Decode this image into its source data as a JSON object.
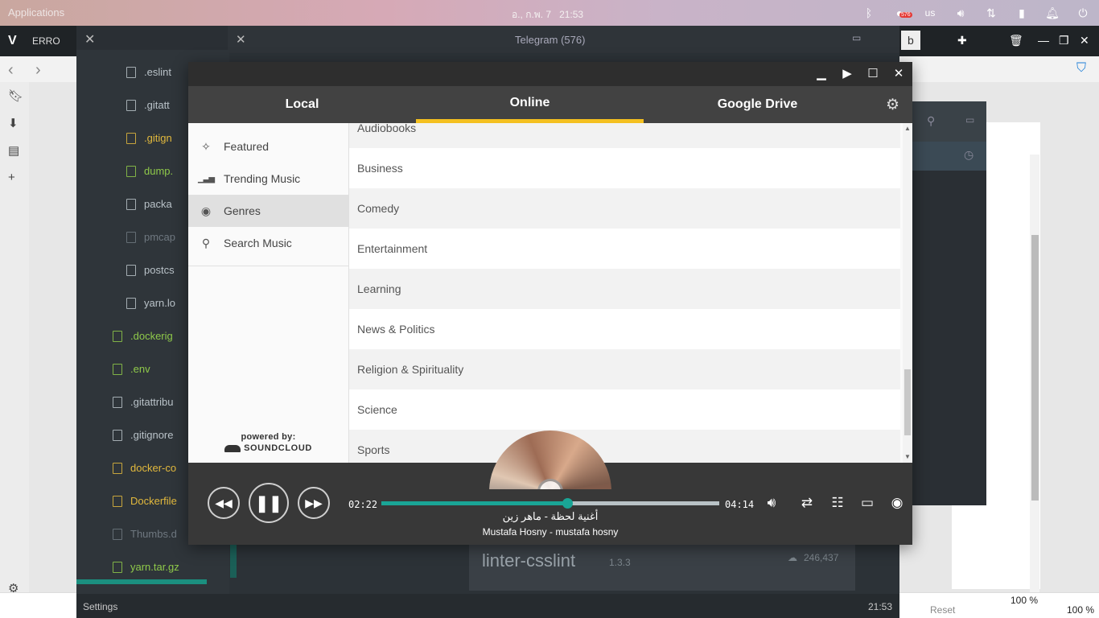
{
  "topbar": {
    "apps_label": "Applications",
    "date": "อ., ก.พ. 7",
    "time": "21:53",
    "lang": "us",
    "badge": "576"
  },
  "browser": {
    "tab_label": "ERRO",
    "tab_suffix": "b",
    "zoom_left": "100 %",
    "zoom_right": "100 %",
    "reset_label": "Reset"
  },
  "editor": {
    "tree_items": [
      {
        "label": ".eslint",
        "color": "#b9c2c8"
      },
      {
        "label": ".gitatt",
        "color": "#b9c2c8"
      },
      {
        "label": ".gitign",
        "color": "#e2b93d"
      },
      {
        "label": "dump.",
        "color": "#8fc94a"
      },
      {
        "label": "packa",
        "color": "#b9c2c8"
      },
      {
        "label": "pmcap",
        "color": "#6f7880"
      },
      {
        "label": "postcs",
        "color": "#b9c2c8"
      },
      {
        "label": "yarn.lo",
        "color": "#b9c2c8"
      }
    ],
    "root_items": [
      {
        "label": ".dockerig",
        "color": "#8fc94a"
      },
      {
        "label": ".env",
        "color": "#8fc94a"
      },
      {
        "label": ".gitattribu",
        "color": "#b9c2c8"
      },
      {
        "label": ".gitignore",
        "color": "#b9c2c8"
      },
      {
        "label": "docker-co",
        "color": "#e2b93d"
      },
      {
        "label": "Dockerfile",
        "color": "#e2b93d"
      },
      {
        "label": "Thumbs.d",
        "color": "#6f7880"
      },
      {
        "label": "yarn.tar.gz",
        "color": "#8fc94a"
      }
    ],
    "status_left": "Settings",
    "status_right": "21:53",
    "telegram_title": "Telegram (576)",
    "package_name": "linter-csslint",
    "package_version": "1.3.3",
    "package_downloads": "246,437"
  },
  "player": {
    "tabs": [
      "Local",
      "Online",
      "Google Drive"
    ],
    "active_tab": "Online",
    "nav": [
      {
        "label": "Featured",
        "icon": "magic-wand-icon",
        "glyph": "✧"
      },
      {
        "label": "Trending Music",
        "icon": "bar-chart-icon",
        "glyph": "▁▃▅"
      },
      {
        "label": "Genres",
        "icon": "podcast-icon",
        "glyph": "◉"
      },
      {
        "label": "Search Music",
        "icon": "search-icon",
        "glyph": "⚲"
      }
    ],
    "selected_nav": "Genres",
    "powered_by": "powered by:",
    "soundcloud": "SOUNDCLOUD",
    "genres": [
      "Audiobooks",
      "Business",
      "Comedy",
      "Entertainment",
      "Learning",
      "News & Politics",
      "Religion & Spirituality",
      "Science",
      "Sports"
    ],
    "elapsed": "02:22",
    "duration": "04:14",
    "progress": 0.55,
    "song_title": "أغنية لحظة - ماهر زين",
    "song_artist": "Mustafa Hosny - mustafa hosny",
    "accent_color": "#1aa596",
    "tab_indicator_color": "#f4c020"
  }
}
